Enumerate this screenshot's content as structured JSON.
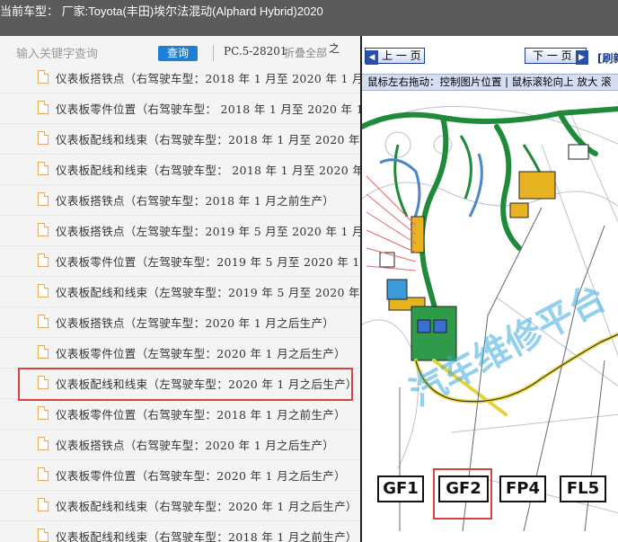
{
  "title": "当前车型： 厂家:Toyota(丰田)埃尔法混动(Alphard Hybrid)2020",
  "search": {
    "placeholder": "输入关键字查询",
    "button_label": "查询",
    "code": "PC.5-28201",
    "fold_all": "折叠全部",
    "extra": "之"
  },
  "list": {
    "items": [
      "仪表板搭铁点（右驾驶车型：2018 年 1 月至 2020 年 1 月",
      "仪表板零件位置（右驾驶车型： 2018 年 1 月至 2020 年 1",
      "仪表板配线和线束（右驾驶车型：2018 年 1 月至 2020 年",
      "仪表板配线和线束（右驾驶车型： 2018 年 1 月至 2020 年",
      "仪表板搭铁点（右驾驶车型：2018 年 1 月之前生产）",
      "仪表板搭铁点（左驾驶车型：2019 年 5 月至 2020 年 1 月",
      "仪表板零件位置（左驾驶车型：2019 年 5 月至 2020 年 1",
      "仪表板配线和线束（左驾驶车型：2019 年 5 月至 2020 年",
      "仪表板搭铁点（左驾驶车型：2020 年 1 月之后生产）",
      "仪表板零件位置（左驾驶车型：2020 年 1 月之后生产）",
      "仪表板配线和线束（左驾驶车型：2020 年 1 月之后生产）",
      "仪表板零件位置（右驾驶车型：2018 年 1 月之前生产）",
      "仪表板搭铁点（右驾驶车型：2020 年 1 月之后生产）",
      "仪表板零件位置（右驾驶车型：2020 年 1 月之后生产）",
      "仪表板配线和线束（右驾驶车型：2020 年 1 月之后生产）",
      "仪表板配线和线束（右驾驶车型：2018 年 1 月之前生产）"
    ],
    "selected_index": 10
  },
  "viewer": {
    "prev_label": "上 一 页",
    "next_label": "下 一 页",
    "refresh_label": "[刷新",
    "hint": "鼠标左右拖动：控制图片位置 | 鼠标滚轮向上 放大  滚",
    "watermark": "汽车维修平台",
    "connectors": [
      "GF1",
      "GF2",
      "FP4",
      "FL5"
    ],
    "selected_connector": "GF2"
  },
  "colors": {
    "titlebar": "#5b5b5b",
    "query_button": "#1e7fd6",
    "highlight": "#d9423e",
    "harness": "#1f8a3a",
    "wire_yellow": "#e6d23a"
  }
}
